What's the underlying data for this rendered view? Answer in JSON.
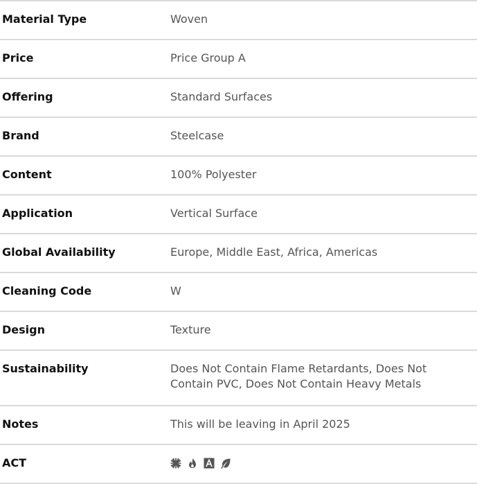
{
  "specs": [
    {
      "label": "Material Type",
      "value": "Woven"
    },
    {
      "label": "Price",
      "value": "Price Group A"
    },
    {
      "label": "Offering",
      "value": "Standard Surfaces"
    },
    {
      "label": "Brand",
      "value": "Steelcase"
    },
    {
      "label": "Content",
      "value": "100% Polyester"
    },
    {
      "label": "Application",
      "value": "Vertical Surface"
    },
    {
      "label": "Global Availability",
      "value": "Europe, Middle East, Africa, Americas"
    },
    {
      "label": "Cleaning Code",
      "value": "W"
    },
    {
      "label": "Design",
      "value": "Texture"
    },
    {
      "label": "Sustainability",
      "value": "Does Not Contain Flame Retardants, Does Not Contain PVC, Does Not Contain Heavy Metals"
    },
    {
      "label": "Notes",
      "value": "This will be leaving in April 2025"
    },
    {
      "label": "ACT",
      "icons": [
        "sunburst-icon",
        "flame-icon",
        "letter-a-icon",
        "leaf-icon"
      ]
    }
  ],
  "colors": {
    "label": "#111111",
    "value": "#555555",
    "divider": "#dadada",
    "icon": "#555555"
  }
}
